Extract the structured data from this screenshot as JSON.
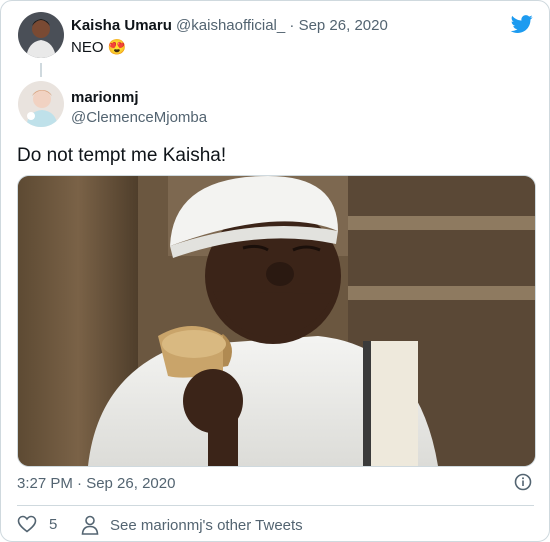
{
  "parent": {
    "name": "Kaisha Umaru",
    "handle": "@kaishaofficial_",
    "separator": "·",
    "date": "Sep 26, 2020",
    "text": "NEO",
    "emoji": "😍"
  },
  "child": {
    "name": "marionmj",
    "handle": "@ClemenceMjomba",
    "text": "Do not tempt me Kaisha!"
  },
  "footer": {
    "timestamp": "3:27 PM · Sep 26, 2020",
    "like_count": "5",
    "see_more": "See marionmj's other Tweets"
  },
  "icons": [
    "twitter-bird-icon",
    "info-icon",
    "heart-icon",
    "person-icon"
  ],
  "colors": {
    "brand": "#1d9bf0",
    "muted": "#536471",
    "border": "#cfd9de"
  }
}
